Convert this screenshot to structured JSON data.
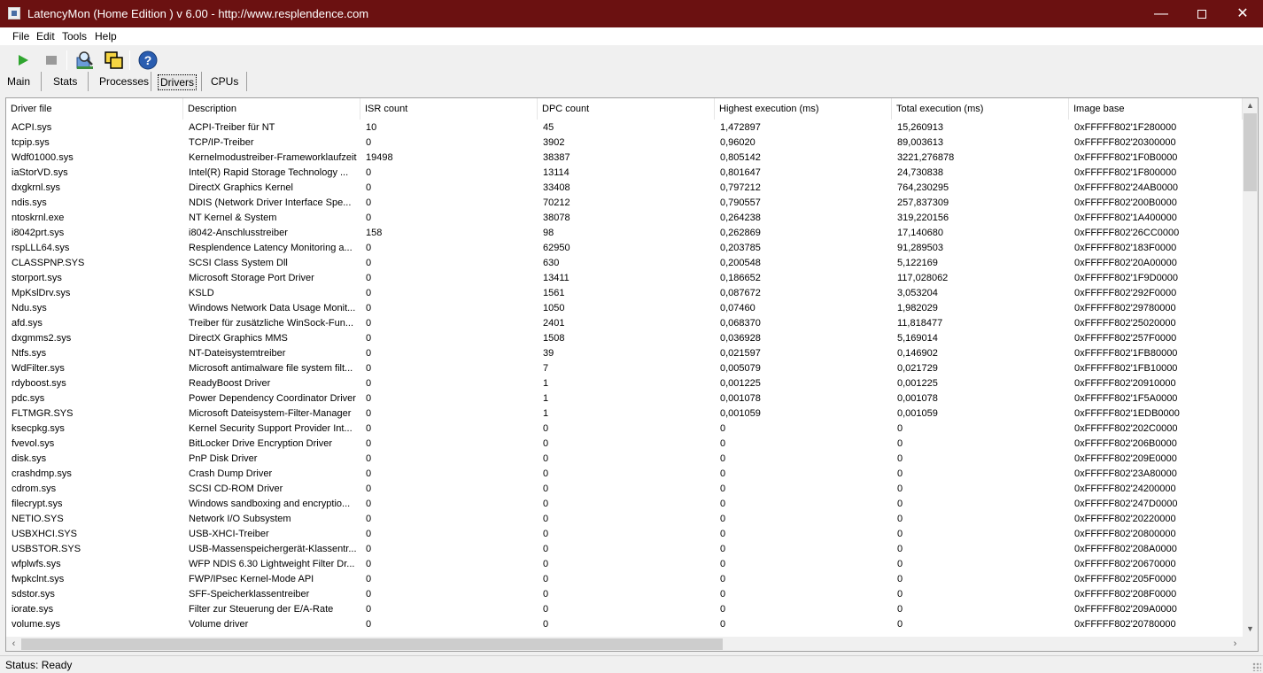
{
  "window": {
    "title": "LatencyMon  (Home Edition )  v 6.00 - http://www.resplendence.com"
  },
  "menu": [
    "File",
    "Edit",
    "Tools",
    "Help"
  ],
  "toolbar": {
    "buttons": [
      {
        "name": "start",
        "icon": "play-icon",
        "color": "#2fa52f"
      },
      {
        "name": "stop",
        "icon": "stop-icon",
        "color": "#9a9a9a"
      },
      {
        "name": "report",
        "icon": "magnifier-report-icon"
      },
      {
        "name": "windows",
        "icon": "windows-icon"
      },
      {
        "name": "help",
        "icon": "help-icon",
        "color": "#2a5db0"
      }
    ]
  },
  "tabs": [
    "Main",
    "Stats",
    "Processes",
    "Drivers",
    "CPUs"
  ],
  "active_tab": "Drivers",
  "table": {
    "columns": [
      "Driver file",
      "Description",
      "ISR count",
      "DPC count",
      "Highest execution (ms)",
      "Total execution (ms)",
      "Image base"
    ],
    "rows": [
      [
        "ACPI.sys",
        "ACPI-Treiber für NT",
        "10",
        "45",
        "1,472897",
        "15,260913",
        "0xFFFFF802'1F280000"
      ],
      [
        "tcpip.sys",
        "TCP/IP-Treiber",
        "0",
        "3902",
        "0,96020",
        "89,003613",
        "0xFFFFF802'20300000"
      ],
      [
        "Wdf01000.sys",
        "Kernelmodustreiber-Frameworklaufzeit",
        "19498",
        "38387",
        "0,805142",
        "3221,276878",
        "0xFFFFF802'1F0B0000"
      ],
      [
        "iaStorVD.sys",
        "Intel(R) Rapid Storage Technology ...",
        "0",
        "13114",
        "0,801647",
        "24,730838",
        "0xFFFFF802'1F800000"
      ],
      [
        "dxgkrnl.sys",
        "DirectX Graphics Kernel",
        "0",
        "33408",
        "0,797212",
        "764,230295",
        "0xFFFFF802'24AB0000"
      ],
      [
        "ndis.sys",
        "NDIS (Network Driver Interface Spe...",
        "0",
        "70212",
        "0,790557",
        "257,837309",
        "0xFFFFF802'200B0000"
      ],
      [
        "ntoskrnl.exe",
        "NT Kernel & System",
        "0",
        "38078",
        "0,264238",
        "319,220156",
        "0xFFFFF802'1A400000"
      ],
      [
        "i8042prt.sys",
        "i8042-Anschlusstreiber",
        "158",
        "98",
        "0,262869",
        "17,140680",
        "0xFFFFF802'26CC0000"
      ],
      [
        "rspLLL64.sys",
        "Resplendence Latency Monitoring a...",
        "0",
        "62950",
        "0,203785",
        "91,289503",
        "0xFFFFF802'183F0000"
      ],
      [
        "CLASSPNP.SYS",
        "SCSI Class System Dll",
        "0",
        "630",
        "0,200548",
        "5,122169",
        "0xFFFFF802'20A00000"
      ],
      [
        "storport.sys",
        "Microsoft Storage Port Driver",
        "0",
        "13411",
        "0,186652",
        "117,028062",
        "0xFFFFF802'1F9D0000"
      ],
      [
        "MpKslDrv.sys",
        "KSLD",
        "0",
        "1561",
        "0,087672",
        "3,053204",
        "0xFFFFF802'292F0000"
      ],
      [
        "Ndu.sys",
        "Windows Network Data Usage Monit...",
        "0",
        "1050",
        "0,07460",
        "1,982029",
        "0xFFFFF802'29780000"
      ],
      [
        "afd.sys",
        "Treiber für zusätzliche WinSock-Fun...",
        "0",
        "2401",
        "0,068370",
        "11,818477",
        "0xFFFFF802'25020000"
      ],
      [
        "dxgmms2.sys",
        "DirectX Graphics MMS",
        "0",
        "1508",
        "0,036928",
        "5,169014",
        "0xFFFFF802'257F0000"
      ],
      [
        "Ntfs.sys",
        "NT-Dateisystemtreiber",
        "0",
        "39",
        "0,021597",
        "0,146902",
        "0xFFFFF802'1FB80000"
      ],
      [
        "WdFilter.sys",
        "Microsoft antimalware file system filt...",
        "0",
        "7",
        "0,005079",
        "0,021729",
        "0xFFFFF802'1FB10000"
      ],
      [
        "rdyboost.sys",
        "ReadyBoost Driver",
        "0",
        "1",
        "0,001225",
        "0,001225",
        "0xFFFFF802'20910000"
      ],
      [
        "pdc.sys",
        "Power Dependency Coordinator Driver",
        "0",
        "1",
        "0,001078",
        "0,001078",
        "0xFFFFF802'1F5A0000"
      ],
      [
        "FLTMGR.SYS",
        "Microsoft Dateisystem-Filter-Manager",
        "0",
        "1",
        "0,001059",
        "0,001059",
        "0xFFFFF802'1EDB0000"
      ],
      [
        "ksecpkg.sys",
        "Kernel Security Support Provider Int...",
        "0",
        "0",
        "0",
        "0",
        "0xFFFFF802'202C0000"
      ],
      [
        "fvevol.sys",
        "BitLocker Drive Encryption Driver",
        "0",
        "0",
        "0",
        "0",
        "0xFFFFF802'206B0000"
      ],
      [
        "disk.sys",
        "PnP Disk Driver",
        "0",
        "0",
        "0",
        "0",
        "0xFFFFF802'209E0000"
      ],
      [
        "crashdmp.sys",
        "Crash Dump Driver",
        "0",
        "0",
        "0",
        "0",
        "0xFFFFF802'23A80000"
      ],
      [
        "cdrom.sys",
        "SCSI CD-ROM Driver",
        "0",
        "0",
        "0",
        "0",
        "0xFFFFF802'24200000"
      ],
      [
        "filecrypt.sys",
        "Windows sandboxing and encryptio...",
        "0",
        "0",
        "0",
        "0",
        "0xFFFFF802'247D0000"
      ],
      [
        "NETIO.SYS",
        "Network I/O Subsystem",
        "0",
        "0",
        "0",
        "0",
        "0xFFFFF802'20220000"
      ],
      [
        "USBXHCI.SYS",
        "USB-XHCI-Treiber",
        "0",
        "0",
        "0",
        "0",
        "0xFFFFF802'20800000"
      ],
      [
        "USBSTOR.SYS",
        "USB-Massenspeichergerät-Klassentr...",
        "0",
        "0",
        "0",
        "0",
        "0xFFFFF802'208A0000"
      ],
      [
        "wfplwfs.sys",
        "WFP NDIS 6.30 Lightweight Filter Dr...",
        "0",
        "0",
        "0",
        "0",
        "0xFFFFF802'20670000"
      ],
      [
        "fwpkclnt.sys",
        "FWP/IPsec Kernel-Mode API",
        "0",
        "0",
        "0",
        "0",
        "0xFFFFF802'205F0000"
      ],
      [
        "sdstor.sys",
        "SFF-Speicherklassentreiber",
        "0",
        "0",
        "0",
        "0",
        "0xFFFFF802'208F0000"
      ],
      [
        "iorate.sys",
        "Filter zur Steuerung der E/A-Rate",
        "0",
        "0",
        "0",
        "0",
        "0xFFFFF802'209A0000"
      ],
      [
        "volume.sys",
        "Volume driver",
        "0",
        "0",
        "0",
        "0",
        "0xFFFFF802'20780000"
      ]
    ]
  },
  "status": "Status: Ready",
  "colors": {
    "titlebar": "#6b1111",
    "accent_play": "#2fa52f",
    "help": "#2a5db0"
  }
}
